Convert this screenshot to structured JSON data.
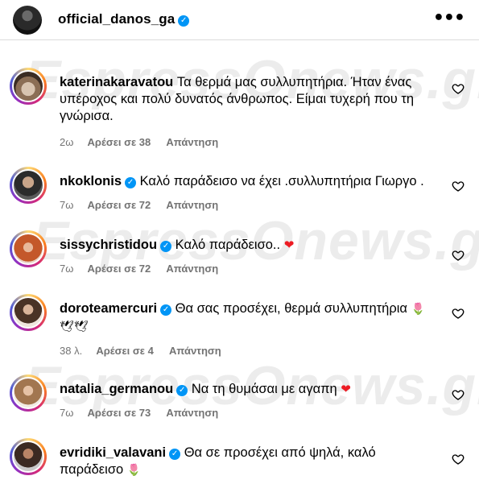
{
  "post_header": {
    "username": "official_danos_ga",
    "more_label": "•••"
  },
  "watermark": "EspressOnews.gr",
  "comments": [
    {
      "username": "katerinakaravatou",
      "verified": false,
      "text": "Τα θερμά μας συλλυπητήρια. Ήταν ένας υπέροχος και πολύ δυνατός άνθρωπος. Είμαι τυχερή που τη γνώρισα.",
      "time": "2ω",
      "likes": "Αρέσει σε 38",
      "reply": "Απάντηση"
    },
    {
      "username": "nkoklonis",
      "verified": true,
      "text": "Καλό παράδεισο να έχει .συλλυπητήρια Γιωργο .",
      "time": "7ω",
      "likes": "Αρέσει σε 72",
      "reply": "Απάντηση"
    },
    {
      "username": "sissychristidou",
      "verified": true,
      "text": "Καλό παράδεισο..",
      "emoji": "❤",
      "time": "7ω",
      "likes": "Αρέσει σε 72",
      "reply": "Απάντηση"
    },
    {
      "username": "doroteamercuri",
      "verified": true,
      "text": "Θα σας προσέχει, θερμά συλλυπητήρια",
      "emoji": "🌷 🕊🕊",
      "time": "38 λ.",
      "likes": "Αρέσει σε 4",
      "reply": "Απάντηση"
    },
    {
      "username": "natalia_germanou",
      "verified": true,
      "text": "Να τη θυμάσαι με αγαπη",
      "emoji": "❤",
      "time": "7ω",
      "likes": "Αρέσει σε 73",
      "reply": "Απάντηση"
    },
    {
      "username": "evridiki_valavani",
      "verified": true,
      "text": "Θα σε προσέχει από ψηλά, καλό παράδεισο",
      "emoji": "🌷",
      "time": "",
      "likes": "",
      "reply": ""
    }
  ],
  "icons": {
    "verified": "verified-badge-icon",
    "like": "heart-outline-icon",
    "more": "more-options-icon"
  },
  "colors": {
    "verified": "#0095f6",
    "meta": "#737373",
    "heart": "#ed1c24"
  }
}
